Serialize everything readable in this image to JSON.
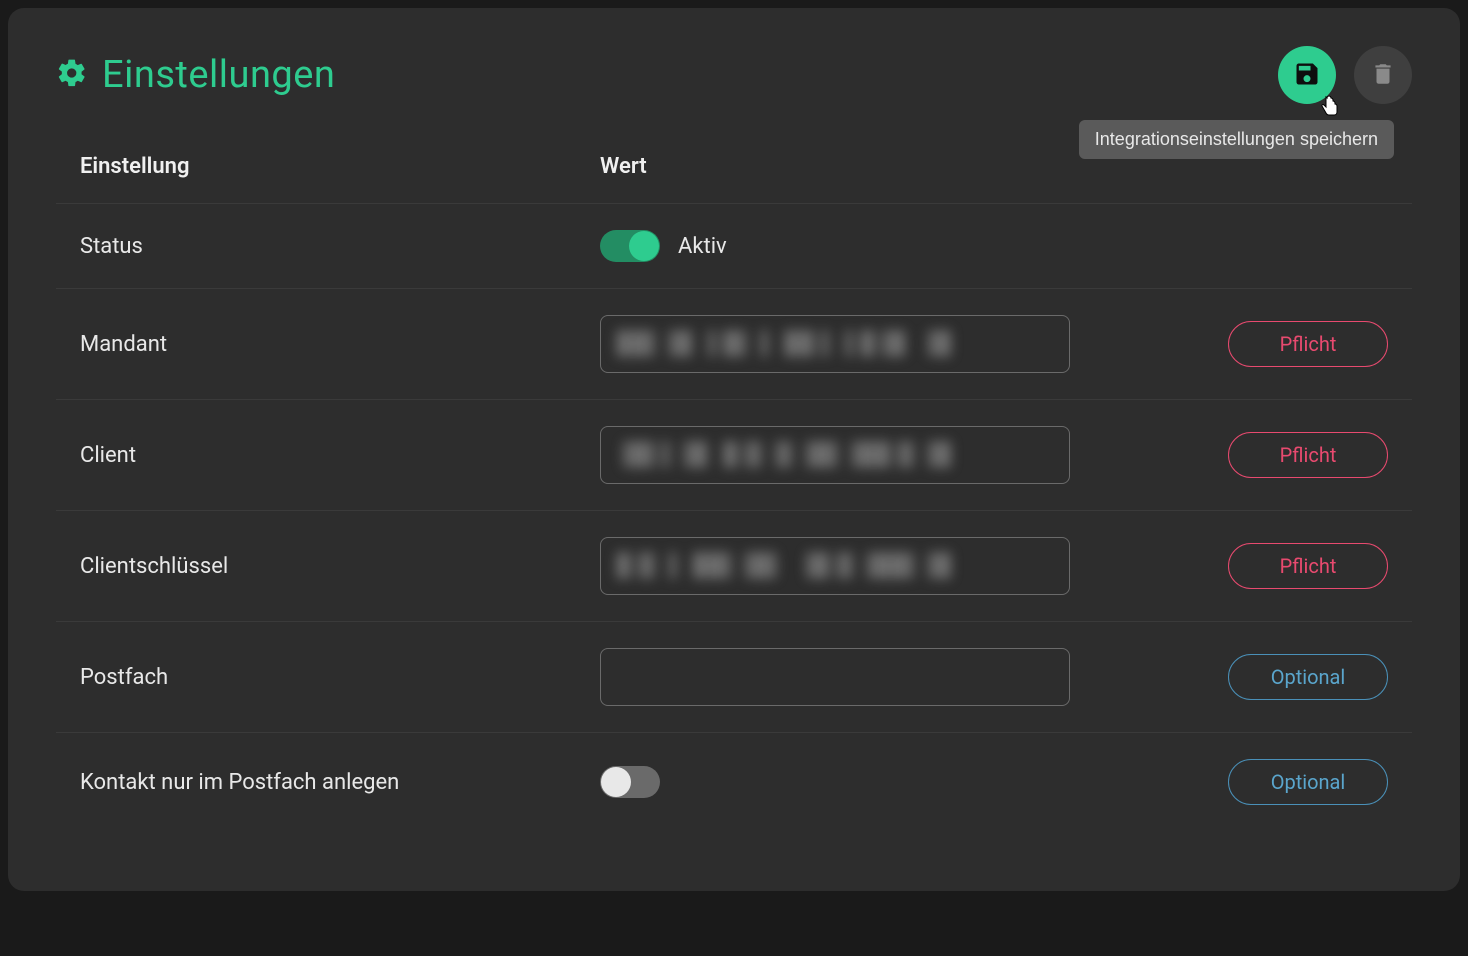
{
  "header": {
    "title": "Einstellungen",
    "save_tooltip": "Integrationseinstellungen speichern"
  },
  "columns": {
    "setting": "Einstellung",
    "value": "Wert"
  },
  "badges": {
    "required": "Pflicht",
    "optional": "Optional"
  },
  "rows": {
    "status": {
      "label": "Status",
      "value_label": "Aktiv",
      "active": true
    },
    "mandant": {
      "label": "Mandant",
      "value": "████████████████",
      "required": true
    },
    "client": {
      "label": "Client",
      "value": "████████████████",
      "required": true
    },
    "client_key": {
      "label": "Clientschlüssel",
      "value": "████████████████",
      "required": true
    },
    "postfach": {
      "label": "Postfach",
      "value": "",
      "required": false
    },
    "contact_only": {
      "label": "Kontakt nur im Postfach anlegen",
      "active": false,
      "required": false
    }
  }
}
